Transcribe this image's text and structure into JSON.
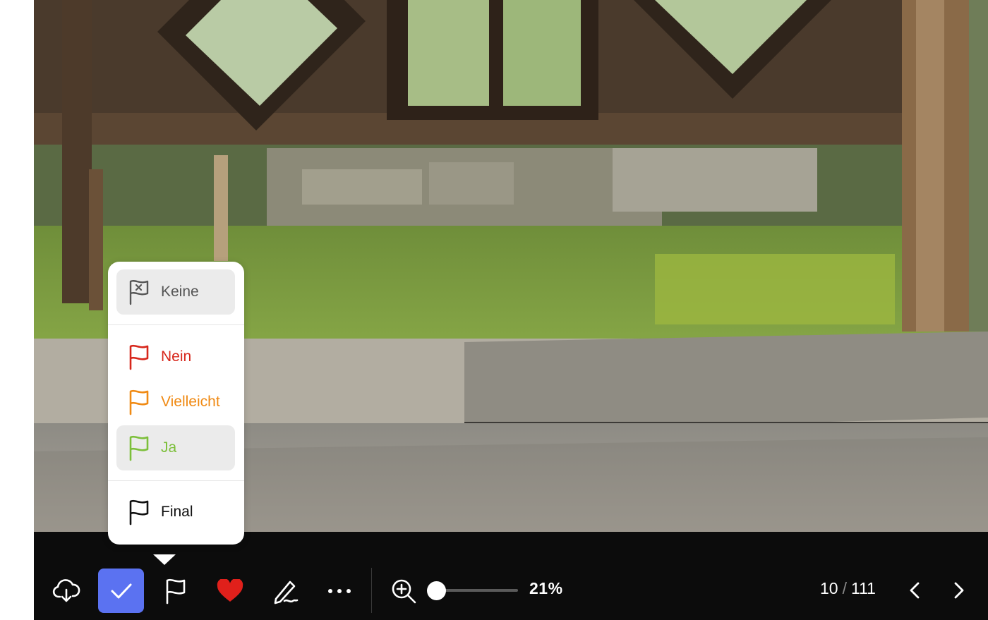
{
  "photo": {
    "description_icon": "photo-viewer-image"
  },
  "flag_menu": {
    "items": [
      {
        "label": "Keine",
        "icon": "flag-none-icon",
        "color": "#555555"
      },
      {
        "label": "Nein",
        "icon": "flag-red-icon",
        "color": "#d7261b"
      },
      {
        "label": "Vielleicht",
        "icon": "flag-orange-icon",
        "color": "#f08a14"
      },
      {
        "label": "Ja",
        "icon": "flag-green-icon",
        "color": "#7cbf3a"
      },
      {
        "label": "Final",
        "icon": "flag-final-icon",
        "color": "#111111"
      }
    ]
  },
  "toolbar": {
    "accent_color": "#5b72f1",
    "heart_color": "#e0201b",
    "zoom_label": "21%",
    "zoom_level": 0.21,
    "counter": {
      "current": "10",
      "separator": "/",
      "total": "111"
    }
  }
}
